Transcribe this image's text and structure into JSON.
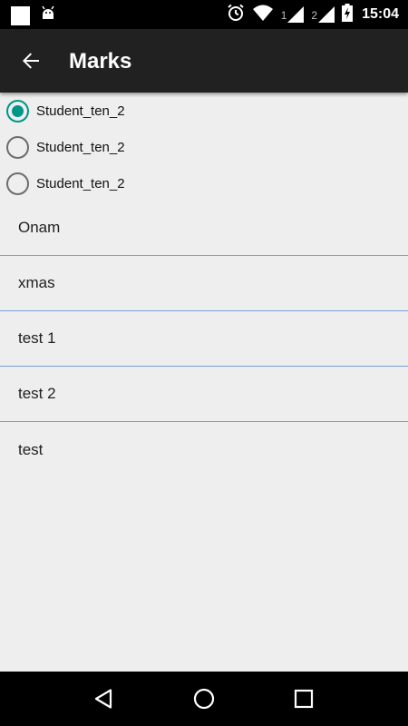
{
  "status_bar": {
    "time": "15:04",
    "sim1": "1",
    "sim2": "2"
  },
  "app_bar": {
    "title": "Marks"
  },
  "students": [
    {
      "label": "Student_ten_2",
      "checked": true
    },
    {
      "label": "Student_ten_2",
      "checked": false
    },
    {
      "label": "Student_ten_2",
      "checked": false
    }
  ],
  "exams": [
    {
      "label": "Onam"
    },
    {
      "label": "xmas"
    },
    {
      "label": "test 1"
    },
    {
      "label": "test 2"
    },
    {
      "label": "test"
    }
  ],
  "icons": {
    "back": "arrow-left-icon",
    "nav_back": "triangle-back-icon",
    "nav_home": "circle-home-icon",
    "nav_recents": "square-recents-icon"
  },
  "colors": {
    "accent": "#009688",
    "divider": "#7a9fd6",
    "app_bar": "#212121",
    "background": "#eeeeee"
  }
}
